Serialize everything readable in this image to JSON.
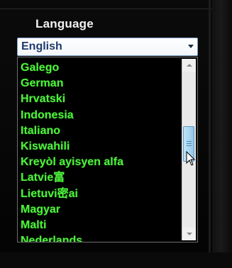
{
  "language_section": {
    "label": "Language",
    "selected_value": "English"
  },
  "dropdown": {
    "options": [
      "Galego",
      "German",
      "Hrvatski",
      "Indonesia",
      "Italiano",
      "Kiswahili",
      "Kreyòl ayisyen alfa",
      "Latvie富",
      "Lietuvi密ai",
      "Magyar",
      "Malti",
      "Nederlands"
    ],
    "scroll_position": 0.45
  },
  "colors": {
    "option_text": "#4cf03a",
    "selected_text": "#1f3a6e",
    "label_text": "#f2f2f2",
    "scroll_thumb": "#a6d4ef"
  },
  "icons": {
    "dropdown_arrow": "chevron-down-icon",
    "scroll_up": "arrow-up-icon",
    "scroll_down": "arrow-down-icon",
    "pointer": "mouse-pointer-icon"
  }
}
